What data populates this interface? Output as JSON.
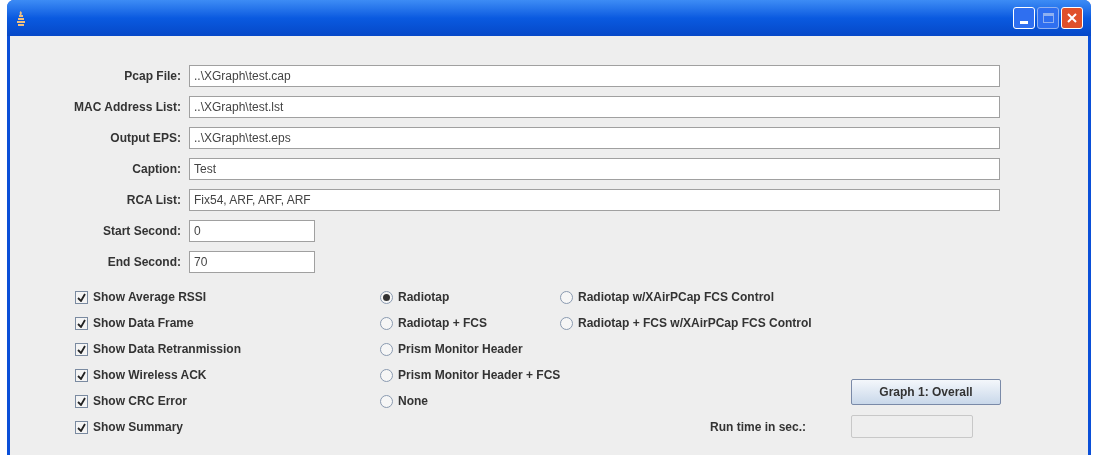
{
  "fields": [
    {
      "label": "Pcap File:",
      "value": "..\\XGraph\\test.cap",
      "kind": "long"
    },
    {
      "label": "MAC Address List:",
      "value": "..\\XGraph\\test.lst",
      "kind": "long"
    },
    {
      "label": "Output EPS:",
      "value": "..\\XGraph\\test.eps",
      "kind": "long"
    },
    {
      "label": "Caption:",
      "value": "Test",
      "kind": "long"
    },
    {
      "label": "RCA List:",
      "value": "Fix54, ARF, ARF, ARF",
      "kind": "long"
    },
    {
      "label": "Start Second:",
      "value": "0",
      "kind": "short"
    },
    {
      "label": "End Second:",
      "value": "70",
      "kind": "short"
    }
  ],
  "checkboxes": [
    {
      "label": "Show Average RSSI",
      "checked": true
    },
    {
      "label": "Show Data Frame",
      "checked": true
    },
    {
      "label": "Show Data Retranmission",
      "checked": true
    },
    {
      "label": "Show Wireless ACK",
      "checked": true
    },
    {
      "label": "Show CRC Error",
      "checked": true
    },
    {
      "label": "Show Summary",
      "checked": true
    }
  ],
  "radio_columns": [
    [
      {
        "label": "Radiotap",
        "selected": true
      },
      {
        "label": "Radiotap + FCS",
        "selected": false
      },
      {
        "label": "Prism Monitor Header",
        "selected": false
      },
      {
        "label": "Prism Monitor Header + FCS",
        "selected": false
      },
      {
        "label": "None",
        "selected": false
      }
    ],
    [
      {
        "label": "Radiotap w/XAirPCap FCS Control",
        "selected": false
      },
      {
        "label": "Radiotap + FCS w/XAirPCap FCS Control",
        "selected": false
      }
    ]
  ],
  "graph_button": "Graph 1: Overall",
  "run_time": {
    "label": "Run time in sec.:",
    "disabled": true
  }
}
